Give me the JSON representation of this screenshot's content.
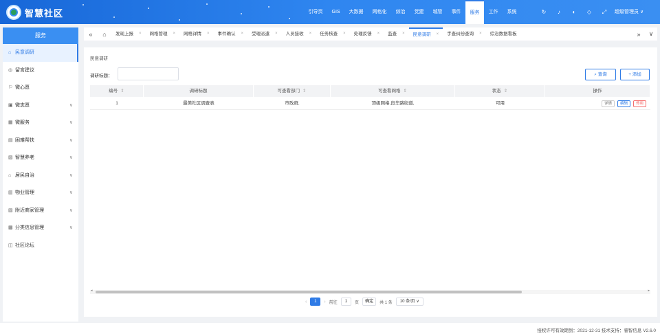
{
  "header": {
    "brand": "智慧社区",
    "nav": [
      "引导页",
      "GIS",
      "大数据",
      "网格化",
      "综治",
      "党建",
      "城管",
      "事件",
      "服务",
      "工作",
      "系统"
    ],
    "active_nav": "服务",
    "user": "超级管理员 ∨",
    "colors": {
      "primary": "#2f7be6",
      "header_start": "#1767d8",
      "header_end": "#3a8ff2"
    }
  },
  "sidebar": {
    "title": "服务",
    "items": [
      {
        "label": "民意调研",
        "icon": "home-icon",
        "glyph": "⌂",
        "active": true,
        "expandable": false
      },
      {
        "label": "留言建议",
        "icon": "message-icon",
        "glyph": "◎",
        "active": false,
        "expandable": false
      },
      {
        "label": "微心愿",
        "icon": "flag-icon",
        "glyph": "⚐",
        "active": false,
        "expandable": false
      },
      {
        "label": "微志愿",
        "icon": "calendar-icon",
        "glyph": "▣",
        "active": false,
        "expandable": true
      },
      {
        "label": "微服务",
        "icon": "grid-icon",
        "glyph": "▦",
        "active": false,
        "expandable": true
      },
      {
        "label": "困难帮扶",
        "icon": "help-icon",
        "glyph": "▤",
        "active": false,
        "expandable": true
      },
      {
        "label": "智慧养老",
        "icon": "elder-icon",
        "glyph": "▨",
        "active": false,
        "expandable": true
      },
      {
        "label": "居民自治",
        "icon": "house-icon",
        "glyph": "⌂",
        "active": false,
        "expandable": true
      },
      {
        "label": "物业管理",
        "icon": "building-icon",
        "glyph": "▥",
        "active": false,
        "expandable": true
      },
      {
        "label": "附近商家管理",
        "icon": "shop-icon",
        "glyph": "▧",
        "active": false,
        "expandable": true
      },
      {
        "label": "分类信息管理",
        "icon": "category-icon",
        "glyph": "▩",
        "active": false,
        "expandable": true
      },
      {
        "label": "社区论坛",
        "icon": "forum-icon",
        "glyph": "◫",
        "active": false,
        "expandable": false
      }
    ]
  },
  "tabs": {
    "items": [
      "发现上报",
      "网格管理",
      "网格详情",
      "事件确认",
      "受理派遣",
      "人员接收",
      "任务核查",
      "处理反馈",
      "监查",
      "民意调研",
      "手查纠纷查询",
      "综治数据看板"
    ],
    "active": "民意调研"
  },
  "main": {
    "breadcrumb": "民意调研",
    "filter_label": "调研标题：",
    "filter_placeholder": "",
    "query_button": "查询",
    "add_button": "添加",
    "table": {
      "columns": [
        "编号",
        "调研标题",
        "可查看部门",
        "可查看网格",
        "状态",
        "操作"
      ],
      "sortable": [
        true,
        false,
        true,
        true,
        true,
        false
      ],
      "rows": [
        {
          "id": "1",
          "title": "最美社区调查表",
          "dept": "市政府,",
          "grid": "顶级网格,良华路街道,",
          "status": "可用"
        }
      ],
      "row_actions": [
        "详情",
        "编辑",
        "停用"
      ]
    },
    "pagination": {
      "current": "1",
      "goto_label": "前往",
      "goto_value": "1",
      "page_suffix": "页",
      "confirm": "确定",
      "total": "共 1 条",
      "page_size": "10 条/页 ∨"
    }
  },
  "footer": {
    "text": "授权许可有效期到：2021-12-31  技术支持：睿智信息  V2.6.0"
  }
}
